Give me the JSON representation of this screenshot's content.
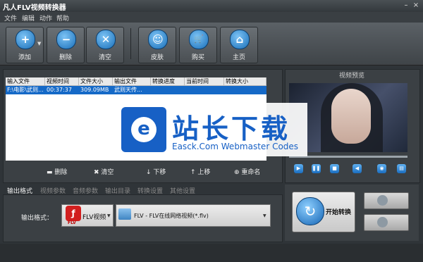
{
  "window": {
    "title": "凡人FLV视频转换器",
    "min": "–",
    "close": "×"
  },
  "menu": [
    "文件",
    "编辑",
    "动作",
    "帮助"
  ],
  "toolbar": [
    {
      "label": "添加",
      "icon": "plus-icon",
      "glyph": "+"
    },
    {
      "label": "删除",
      "icon": "minus-icon",
      "glyph": "−"
    },
    {
      "label": "清空",
      "icon": "clear-x-icon",
      "glyph": "✕"
    },
    {
      "label": "皮肤",
      "icon": "smiley-icon",
      "glyph": "☺"
    },
    {
      "label": "购买",
      "icon": "cart-icon",
      "glyph": "🛒"
    },
    {
      "label": "主页",
      "icon": "home-icon",
      "glyph": "⌂"
    }
  ],
  "table": {
    "headers": [
      "输入文件",
      "视频时间",
      "文件大小",
      "输出文件",
      "转换进度",
      "当前时间",
      "转换大小"
    ],
    "rows": [
      [
        "F:\\电影\\武则...",
        "00:37:37",
        "309.09MB",
        "武则天传...",
        "",
        "",
        ""
      ]
    ]
  },
  "list_controls": [
    "删除",
    "清空",
    "下移",
    "上移",
    "重命名"
  ],
  "preview": {
    "title": "视频预览"
  },
  "tabs": [
    "输出格式",
    "视频参数",
    "音频参数",
    "输出目录",
    "转换设置",
    "其他设置"
  ],
  "output": {
    "label": "输出格式：",
    "format": "FLV视频",
    "logo_text": "FLV",
    "profile": "FLV - FLV在线网络视频(*.flv)"
  },
  "convert": {
    "label": "开始转换"
  },
  "watermark": {
    "cn": "站长下载",
    "en": "Easck.Com Webmaster Codes",
    "logo": "e"
  }
}
